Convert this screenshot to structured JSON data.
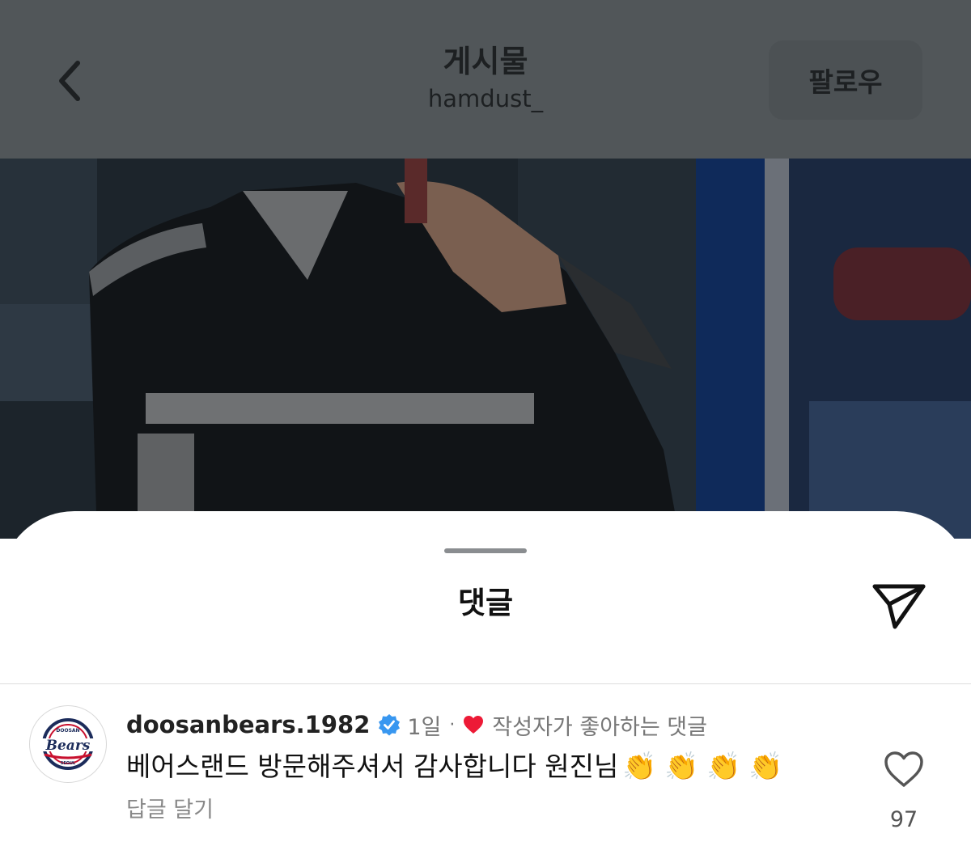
{
  "header": {
    "title": "게시물",
    "username": "hamdust_",
    "follow_label": "팔로우"
  },
  "sheet": {
    "title": "댓글"
  },
  "comment": {
    "username": "doosanbears.1982",
    "verified": true,
    "time": "1일",
    "separator": "·",
    "liked_by_author": "작성자가 좋아하는 댓글",
    "text": "베어스랜드 방문해주셔서 감사합니다 원진님",
    "emojis": [
      "👏",
      "👏",
      "👏",
      "👏"
    ],
    "reply_label": "답글 달기",
    "like_count": "97",
    "avatar_logo_text": "Bears",
    "avatar_logo_top": "DOOSAN",
    "avatar_logo_bottom": "SEOUL"
  },
  "icons": {
    "back": "chevron-left-icon",
    "share": "paper-plane-icon",
    "verified": "verified-badge-icon",
    "author_like": "heart-filled-icon",
    "like": "heart-outline-icon"
  },
  "colors": {
    "overlay": "#515659",
    "verified_blue": "#3897f0",
    "heart_red": "#ed1a36"
  }
}
